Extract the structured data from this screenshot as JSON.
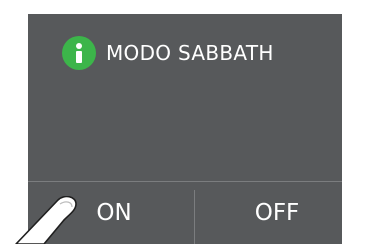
{
  "dialog": {
    "title": "MODO SABBATH",
    "icon": "info-icon"
  },
  "buttons": {
    "on_label": "ON",
    "off_label": "OFF"
  },
  "colors": {
    "panel_background": "#57595b",
    "icon_accent": "#3cb54a",
    "text": "#ffffff"
  }
}
